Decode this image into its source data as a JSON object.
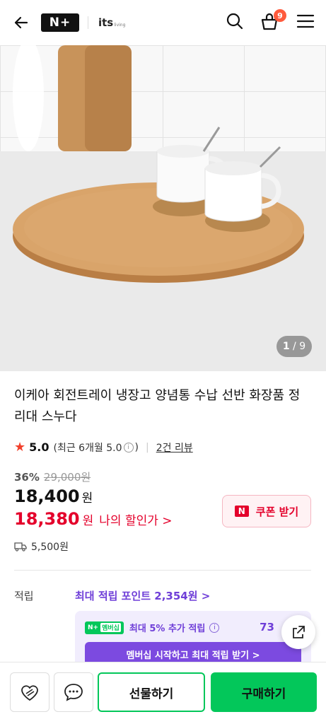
{
  "header": {
    "brand_badge": "N+",
    "store_logo": "its",
    "store_logo_sub": "living",
    "cart_count": "9",
    "icons": [
      "back-arrow-icon",
      "search-icon",
      "cart-icon",
      "menu-icon"
    ]
  },
  "gallery": {
    "current": "1",
    "separator": "/",
    "total": "9"
  },
  "product": {
    "title": "이케아 회전트레이 냉장고 양념통 수납 선반 화장품 정리대 스누다",
    "rating": "5.0",
    "recent_rating": "(최근 6개월 5.0",
    "recent_rating_close": ")",
    "reviews": "2건 리뷰",
    "discount_rate": "36%",
    "original_price": "29,000원",
    "price": "18,400",
    "price_unit": "원",
    "n_price": "18,380",
    "n_price_unit": "원",
    "n_price_label": "나의 할인가 >",
    "coupon_label": "쿠폰 받기",
    "coupon_icon": "N",
    "shipping": "5,500원"
  },
  "points": {
    "label": "적립",
    "link": "최대 적립 포인트 2,354원 >",
    "member_chip": "N+",
    "member_chip_label": "멤버십",
    "member_text": "최대 5% 추가 적립",
    "member_points": "73",
    "member_button": "멤버십 시작하고 최대 적립 받기 >"
  },
  "bottom_bar": {
    "gift": "선물하기",
    "buy": "구매하기"
  },
  "colors": {
    "naver_green": "#03c75a",
    "sale_red": "#e4002b",
    "member_purple": "#6f3fd8"
  }
}
